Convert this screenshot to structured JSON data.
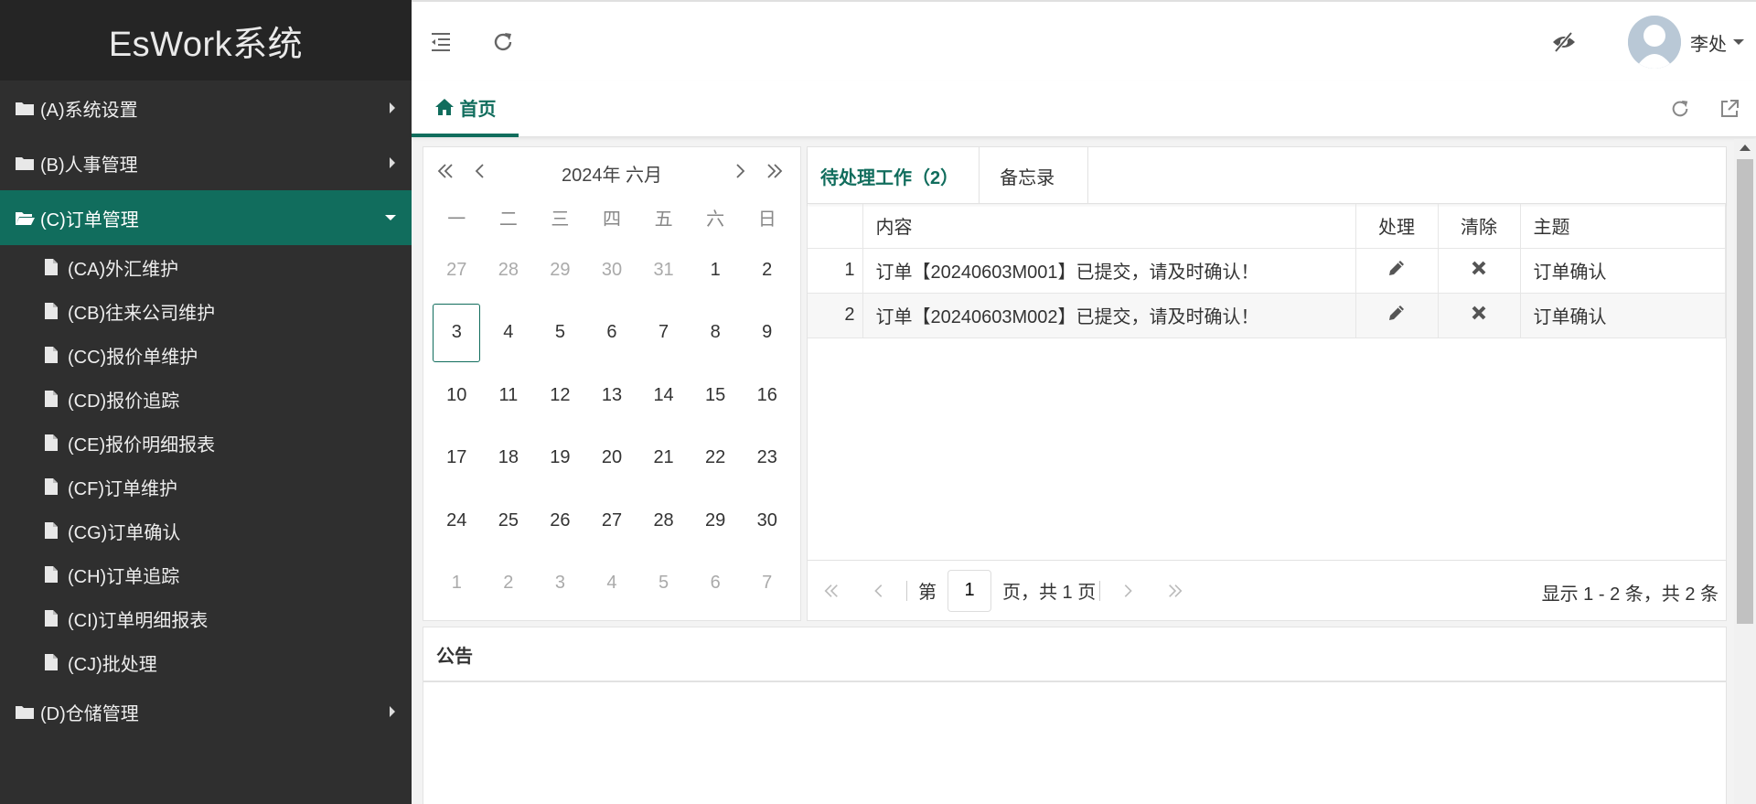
{
  "app": {
    "title": "EsWork系统"
  },
  "sidebar": {
    "groups": [
      {
        "label": "(A)系统设置"
      },
      {
        "label": "(B)人事管理"
      },
      {
        "label": "(C)订单管理"
      },
      {
        "label": "(D)仓储管理"
      }
    ],
    "sub_items": [
      {
        "label": "(CA)外汇维护"
      },
      {
        "label": "(CB)往来公司维护"
      },
      {
        "label": "(CC)报价单维护"
      },
      {
        "label": "(CD)报价追踪"
      },
      {
        "label": "(CE)报价明细报表"
      },
      {
        "label": "(CF)订单维护"
      },
      {
        "label": "(CG)订单确认"
      },
      {
        "label": "(CH)订单追踪"
      },
      {
        "label": "(CI)订单明细报表"
      },
      {
        "label": "(CJ)批处理"
      }
    ]
  },
  "topbar": {
    "user_name": "李处"
  },
  "tabs": {
    "home_label": "首页"
  },
  "calendar": {
    "title": "2024年 六月",
    "weekdays": [
      "一",
      "二",
      "三",
      "四",
      "五",
      "六",
      "日"
    ],
    "days": [
      "27",
      "28",
      "29",
      "30",
      "31",
      "1",
      "2",
      "3",
      "4",
      "5",
      "6",
      "7",
      "8",
      "9",
      "10",
      "11",
      "12",
      "13",
      "14",
      "15",
      "16",
      "17",
      "18",
      "19",
      "20",
      "21",
      "22",
      "23",
      "24",
      "25",
      "26",
      "27",
      "28",
      "29",
      "30",
      "1",
      "2",
      "3",
      "4",
      "5",
      "6",
      "7"
    ]
  },
  "todo": {
    "tab_pending": "待处理工作（2）",
    "tab_memo": "备忘录",
    "columns": {
      "content": "内容",
      "handle": "处理",
      "clear": "清除",
      "subject": "主题"
    },
    "rows": [
      {
        "num": "1",
        "content": "订单【20240603M001】已提交，请及时确认！",
        "subject": "订单确认"
      },
      {
        "num": "2",
        "content": "订单【20240603M002】已提交，请及时确认！",
        "subject": "订单确认"
      }
    ],
    "pager": {
      "prefix": "第",
      "page": "1",
      "suffix": "页，共 1 页",
      "summary": "显示 1 - 2 条，共 2 条"
    }
  },
  "notice": {
    "title": "公告"
  },
  "colors": {
    "accent": "#116d5d",
    "sidebar_bg": "#2f2f2f",
    "logo_bg": "#252525"
  },
  "icons": [
    "folder-icon",
    "folder-open-icon",
    "file-icon",
    "menu-collapse-icon",
    "refresh-icon",
    "eye-slash-icon",
    "user-avatar",
    "caret-down-icon",
    "home-icon",
    "external-link-icon",
    "pencil-icon",
    "close-icon"
  ]
}
